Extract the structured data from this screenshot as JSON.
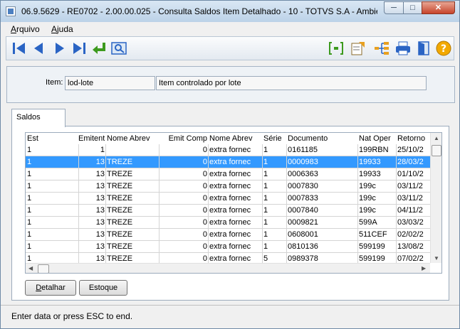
{
  "window": {
    "title": "06.9.5629 - RE0702 - 2.00.00.025 - Consulta Saldos Item Detalhado - 10 - TOTVS S.A - Ambie..."
  },
  "menu": {
    "arquivo": {
      "first": "A",
      "rest": "rquivo"
    },
    "ajuda": {
      "first": "A",
      "rest": "juda"
    }
  },
  "toolbar": {
    "icons": [
      "first-record-icon",
      "previous-record-icon",
      "next-record-icon",
      "last-record-icon",
      "return-icon",
      "zoom-icon",
      "bracket-select-icon",
      "report-icon",
      "hierarchy-icon",
      "print-icon",
      "exit-door-icon",
      "help-icon"
    ]
  },
  "item": {
    "label": "Item:",
    "code": "lod-lote",
    "description": "Item controlado por lote"
  },
  "tabs": {
    "saldos": "Saldos"
  },
  "grid": {
    "columns": [
      "Est",
      "Emitente",
      "Nome Abrev",
      "Emit Comp",
      "Nome Abrev",
      "Série",
      "Documento",
      "Nat Oper",
      "Retorno"
    ],
    "rows": [
      [
        "1",
        "1",
        "",
        "0",
        "extra fornec",
        "1",
        "0161185",
        "199RBN",
        "25/10/2"
      ],
      [
        "1",
        "13",
        "TREZE",
        "0",
        "extra fornec",
        "1",
        "0000983",
        "19933",
        "28/03/2"
      ],
      [
        "1",
        "13",
        "TREZE",
        "0",
        "extra fornec",
        "1",
        "0006363",
        "19933",
        "01/10/2"
      ],
      [
        "1",
        "13",
        "TREZE",
        "0",
        "extra fornec",
        "1",
        "0007830",
        "199c",
        "03/11/2"
      ],
      [
        "1",
        "13",
        "TREZE",
        "0",
        "extra fornec",
        "1",
        "0007833",
        "199c",
        "03/11/2"
      ],
      [
        "1",
        "13",
        "TREZE",
        "0",
        "extra fornec",
        "1",
        "0007840",
        "199c",
        "04/11/2"
      ],
      [
        "1",
        "13",
        "TREZE",
        "0",
        "extra fornec",
        "1",
        "0009821",
        "599A",
        "03/03/2"
      ],
      [
        "1",
        "13",
        "TREZE",
        "0",
        "extra fornec",
        "1",
        "0608001",
        "511CEF",
        "02/02/2"
      ],
      [
        "1",
        "13",
        "TREZE",
        "0",
        "extra fornec",
        "1",
        "0810136",
        "599199",
        "13/08/2"
      ],
      [
        "1",
        "13",
        "TREZE",
        "0",
        "extra fornec",
        "5",
        "0989378",
        "599199",
        "07/02/2"
      ]
    ],
    "selected_row": 1
  },
  "buttons": {
    "detalhar": {
      "first": "D",
      "rest": "etalhar"
    },
    "estoque": "Estoque"
  },
  "status": "Enter data or press ESC to end.",
  "colors": {
    "selection": "#3399ff",
    "title_bg": "#c3d4e6",
    "close": "#c7442b"
  }
}
